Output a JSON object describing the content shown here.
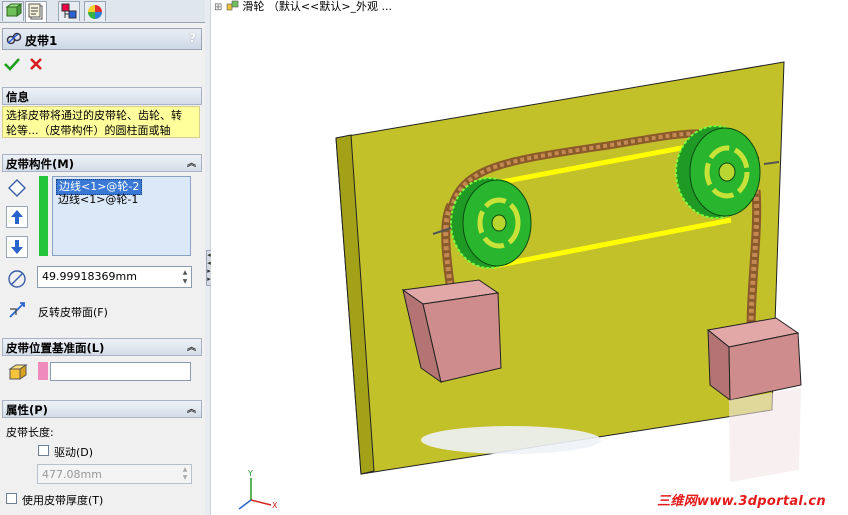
{
  "panel": {
    "tabs": [
      "feature-manager-icon",
      "property-manager-icon",
      "configuration-manager-icon",
      "appearance-manager-icon"
    ],
    "title": "皮带1",
    "help": "?",
    "ok_icon": "checkmark-icon",
    "cancel_icon": "cross-icon",
    "sections": {
      "info": {
        "title": "信息",
        "text_line1": "选择皮带将通过的皮带轮、齿轮、转",
        "text_line2": "轮等...（皮带构件）的圆柱面或轴"
      },
      "members": {
        "title": "皮带构件(M)",
        "items": [
          "边线<1>@轮-2",
          "边线<1>@轮-1"
        ],
        "diameter": "49.99918369mm",
        "flip_label": "反转皮带面(F)"
      },
      "plane": {
        "title": "皮带位置基准面(L)",
        "value": ""
      },
      "props": {
        "title": "属性(P)",
        "length_label": "皮带长度:",
        "drive_label": "驱动(D)",
        "length_value": "477.08mm",
        "thickness_label": "使用皮带厚度(T)"
      }
    }
  },
  "viewport": {
    "tree_text": "滑轮 （默认<<默认>_外观 ...",
    "watermark": "三维网www.3dportal.cn"
  },
  "colors": {
    "board": "#c3c12a",
    "block": "#cf8c8c",
    "pulley": "#29b52e",
    "belt": "#ffff00",
    "selection": "#3a78d6"
  }
}
